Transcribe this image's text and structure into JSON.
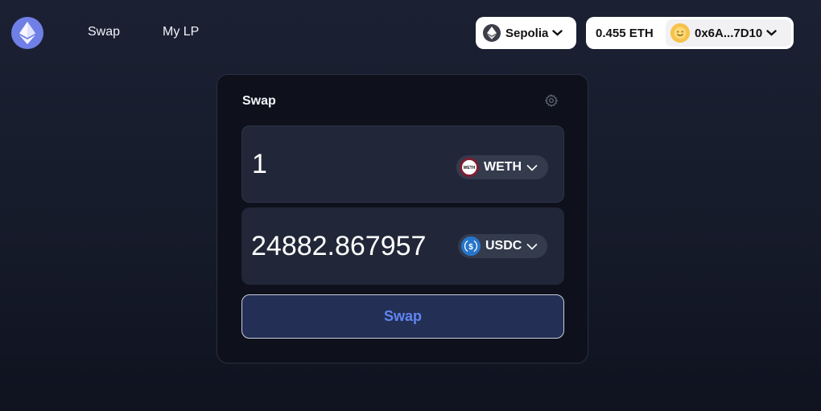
{
  "nav": {
    "logo_icon": "ethereum-icon",
    "links": [
      {
        "label": "Swap"
      },
      {
        "label": "My LP"
      }
    ]
  },
  "network": {
    "icon": "ethereum-icon",
    "label": "Sepolia"
  },
  "wallet": {
    "balance": "0.455 ETH",
    "avatar_icon": "smiley-avatar",
    "address": "0x6A...7D10"
  },
  "swap_card": {
    "title": "Swap",
    "settings_icon": "gear-icon",
    "from": {
      "amount": "1",
      "token": "WETH",
      "token_icon_text": "WETH"
    },
    "to": {
      "amount": "24882.867957",
      "token": "USDC"
    },
    "button_label": "Swap"
  },
  "colors": {
    "background": "#1b2133",
    "card": "#0e111b",
    "input_box": "#212738",
    "accent": "#5f86f0",
    "logo": "#6f7fe6"
  }
}
